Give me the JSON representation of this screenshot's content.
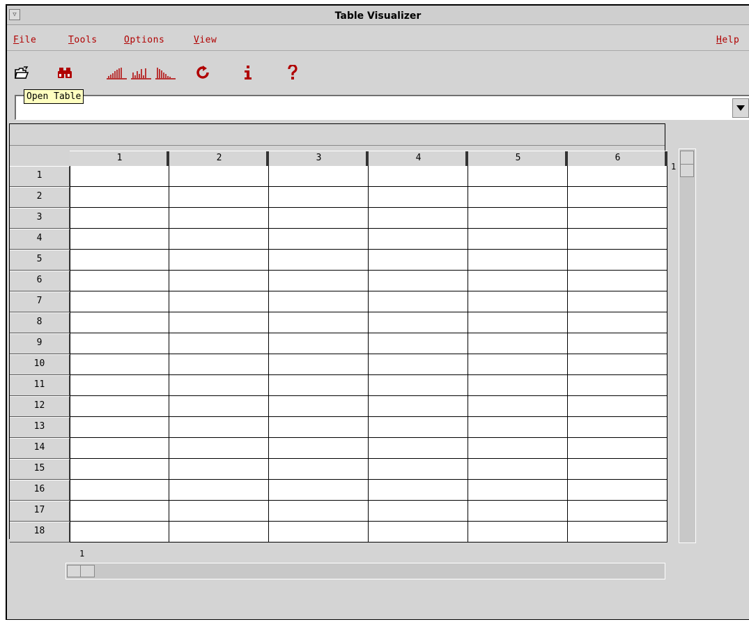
{
  "window": {
    "title": "Table Visualizer"
  },
  "menubar": {
    "items": [
      {
        "label": "File",
        "mnemonic": "F",
        "rest": "ile"
      },
      {
        "label": "Tools",
        "mnemonic": "T",
        "rest": "ools"
      },
      {
        "label": "Options",
        "mnemonic": "O",
        "rest": "ptions"
      },
      {
        "label": "View",
        "mnemonic": "V",
        "rest": "iew"
      }
    ],
    "help": {
      "label": "Help",
      "mnemonic": "H",
      "rest": "elp"
    }
  },
  "toolbar": {
    "buttons": [
      {
        "icon": "open-folder-icon"
      },
      {
        "icon": "binoculars-icon"
      },
      {
        "icon": "histogram-ascending-icon"
      },
      {
        "icon": "histogram-icon"
      },
      {
        "icon": "histogram-descending-icon"
      },
      {
        "icon": "refresh-icon"
      },
      {
        "icon": "info-icon"
      },
      {
        "icon": "help-icon"
      }
    ],
    "tooltip": "Open Table",
    "accent_color": "#b00000"
  },
  "combo": {
    "value": ""
  },
  "table": {
    "columns": [
      "1",
      "2",
      "3",
      "4",
      "5",
      "6"
    ],
    "rows": [
      "1",
      "2",
      "3",
      "4",
      "5",
      "6",
      "7",
      "8",
      "9",
      "10",
      "11",
      "12",
      "13",
      "14",
      "15",
      "16",
      "17",
      "18"
    ]
  },
  "vscroll": {
    "label": "1"
  },
  "hscroll": {
    "label": "1"
  }
}
